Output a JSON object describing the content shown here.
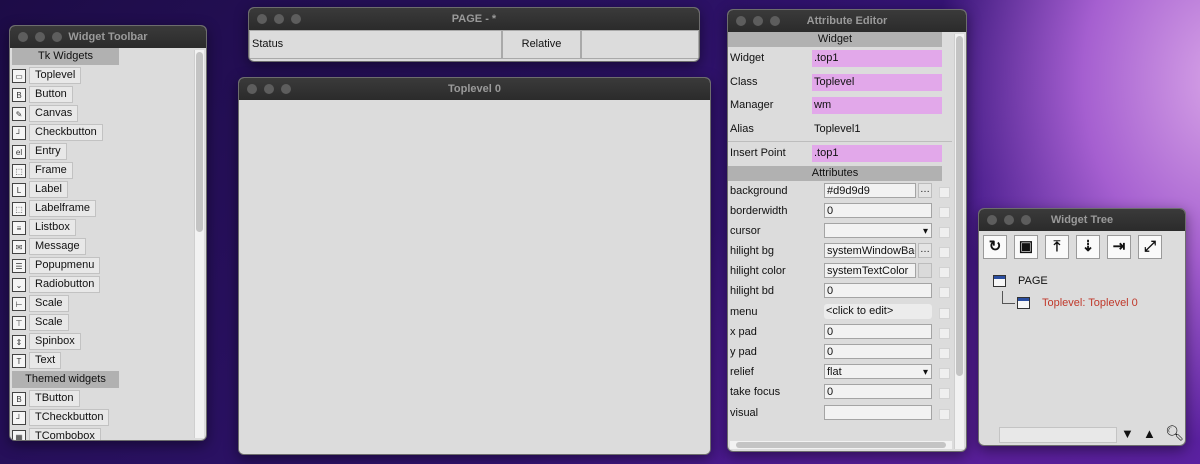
{
  "widget_toolbar": {
    "title": "Widget Toolbar",
    "tk_header": "Tk Widgets",
    "tk_items": [
      {
        "label": "Toplevel",
        "icon": "toplevel-icon",
        "glyph": "▭"
      },
      {
        "label": "Button",
        "icon": "button-icon",
        "glyph": "B"
      },
      {
        "label": "Canvas",
        "icon": "canvas-icon",
        "glyph": "✎"
      },
      {
        "label": "Checkbutton",
        "icon": "checkbutton-icon",
        "glyph": "┘"
      },
      {
        "label": "Entry",
        "icon": "entry-icon",
        "glyph": "el"
      },
      {
        "label": "Frame",
        "icon": "frame-icon",
        "glyph": "⬚"
      },
      {
        "label": "Label",
        "icon": "label-icon",
        "glyph": "L"
      },
      {
        "label": "Labelframe",
        "icon": "labelframe-icon",
        "glyph": "⬚"
      },
      {
        "label": "Listbox",
        "icon": "listbox-icon",
        "glyph": "≡"
      },
      {
        "label": "Message",
        "icon": "message-icon",
        "glyph": "✉"
      },
      {
        "label": "Popupmenu",
        "icon": "popupmenu-icon",
        "glyph": "☰"
      },
      {
        "label": "Radiobutton",
        "icon": "radiobutton-icon",
        "glyph": "⌄"
      },
      {
        "label": "Scale",
        "icon": "scale-vertical-icon",
        "glyph": "⊢"
      },
      {
        "label": "Scale",
        "icon": "scale-horizontal-icon",
        "glyph": "⊤"
      },
      {
        "label": "Spinbox",
        "icon": "spinbox-icon",
        "glyph": "⇕"
      },
      {
        "label": "Text",
        "icon": "text-icon",
        "glyph": "T"
      }
    ],
    "themed_header": "Themed widgets",
    "themed_items": [
      {
        "label": "TButton",
        "icon": "tbutton-icon",
        "glyph": "B"
      },
      {
        "label": "TCheckbutton",
        "icon": "tcheckbutton-icon",
        "glyph": "┘"
      },
      {
        "label": "TCombobox",
        "icon": "tcombobox-icon",
        "glyph": "▦"
      }
    ]
  },
  "page_window": {
    "title": "PAGE - *",
    "status_label": "Status",
    "relative_label": "Relative",
    "extra_label": ""
  },
  "toplevel_window": {
    "title": "Toplevel 0"
  },
  "attribute_editor": {
    "title": "Attribute Editor",
    "widget_header": "Widget",
    "widget_fields": [
      {
        "key": "Widget",
        "value": ".top1",
        "highlight": true
      },
      {
        "key": "Class",
        "value": "Toplevel",
        "highlight": true
      },
      {
        "key": "Manager",
        "value": "wm",
        "highlight": true
      },
      {
        "key": "Alias",
        "value": "Toplevel1",
        "highlight": false
      },
      {
        "key": "Insert Point",
        "value": ".top1",
        "highlight": true
      }
    ],
    "attributes_header": "Attributes",
    "attributes": [
      {
        "key": "background",
        "value": "#d9d9d9",
        "kind": "button"
      },
      {
        "key": "borderwidth",
        "value": "0",
        "kind": "entry"
      },
      {
        "key": "cursor",
        "value": "",
        "kind": "select"
      },
      {
        "key": "hilight bg",
        "value": "systemWindowBac",
        "kind": "button"
      },
      {
        "key": "hilight color",
        "value": "systemTextColor",
        "kind": "colorbox"
      },
      {
        "key": "hilight bd",
        "value": "0",
        "kind": "entry"
      },
      {
        "key": "menu",
        "value": "<click to edit>",
        "kind": "plain"
      },
      {
        "key": "x pad",
        "value": "0",
        "kind": "entry"
      },
      {
        "key": "y pad",
        "value": "0",
        "kind": "entry"
      },
      {
        "key": "relief",
        "value": "flat",
        "kind": "select"
      },
      {
        "key": "take focus",
        "value": "0",
        "kind": "entry"
      },
      {
        "key": "visual",
        "value": "",
        "kind": "entry"
      }
    ]
  },
  "widget_tree": {
    "title": "Widget Tree",
    "tools": [
      {
        "name": "refresh-icon",
        "glyph": "↻"
      },
      {
        "name": "save-icon",
        "glyph": "▣"
      },
      {
        "name": "move-top-icon",
        "glyph": "⤒"
      },
      {
        "name": "move-down-icon",
        "glyph": "⇣"
      },
      {
        "name": "export-icon",
        "glyph": "⇥"
      },
      {
        "name": "expand-icon",
        "glyph": "⤢"
      }
    ],
    "root_label": "PAGE",
    "child_label": "Toplevel: Toplevel 0",
    "child_color": "#c0392b"
  }
}
